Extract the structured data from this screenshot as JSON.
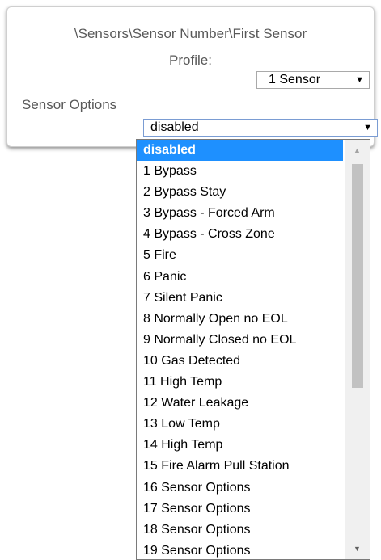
{
  "panel": {
    "path_text": "\\Sensors\\Sensor Number\\First Sensor",
    "profile_label": "Profile:",
    "profile_value": "1 Sensor",
    "options_label": "Sensor Options",
    "options_value": "disabled"
  },
  "icons": {
    "dropdown_arrow": "▼",
    "scroll_up": "▲",
    "scroll_down": "▼"
  },
  "dropdown": {
    "selected_index": 0,
    "items": [
      "disabled",
      "1 Bypass",
      "2 Bypass Stay",
      "3 Bypass - Forced Arm",
      "4 Bypass - Cross Zone",
      "5 Fire",
      "6 Panic",
      "7 Silent Panic",
      "8 Normally Open no EOL",
      "9 Normally Closed no EOL",
      "10 Gas Detected",
      "11 High Temp",
      "12 Water Leakage",
      "13 Low Temp",
      "14 High Temp",
      "15 Fire Alarm Pull Station",
      "16 Sensor Options",
      "17 Sensor Options",
      "18 Sensor Options",
      "19 Sensor Options"
    ]
  },
  "colors": {
    "selected_bg": "#1e90ff",
    "label_text": "#595959"
  }
}
